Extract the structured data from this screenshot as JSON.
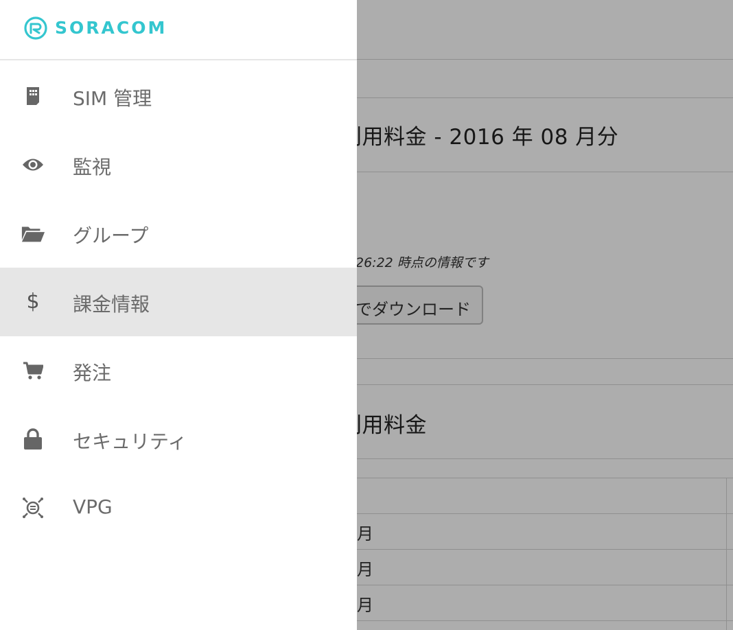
{
  "brand": {
    "name": "SORACOM",
    "color": "#34c6cf"
  },
  "nav": {
    "items": [
      {
        "label": "SIM 管理",
        "icon": "sim-card-icon"
      },
      {
        "label": "監視",
        "icon": "eye-icon"
      },
      {
        "label": "グループ",
        "icon": "folder-open-icon"
      },
      {
        "label": "課金情報",
        "icon": "dollar-icon",
        "active": true
      },
      {
        "label": "発注",
        "icon": "cart-icon"
      },
      {
        "label": "セキュリティ",
        "icon": "lock-icon"
      },
      {
        "label": "VPG",
        "icon": "vpg-icon"
      }
    ]
  },
  "background": {
    "section1_title": "利用料金 - 2016 年 08 月分",
    "timestamp_note": "26:22 時点の情報です",
    "download_button": "でダウンロード",
    "section2_title": "利用料金",
    "table_rows": [
      "月",
      "月",
      "月"
    ]
  }
}
